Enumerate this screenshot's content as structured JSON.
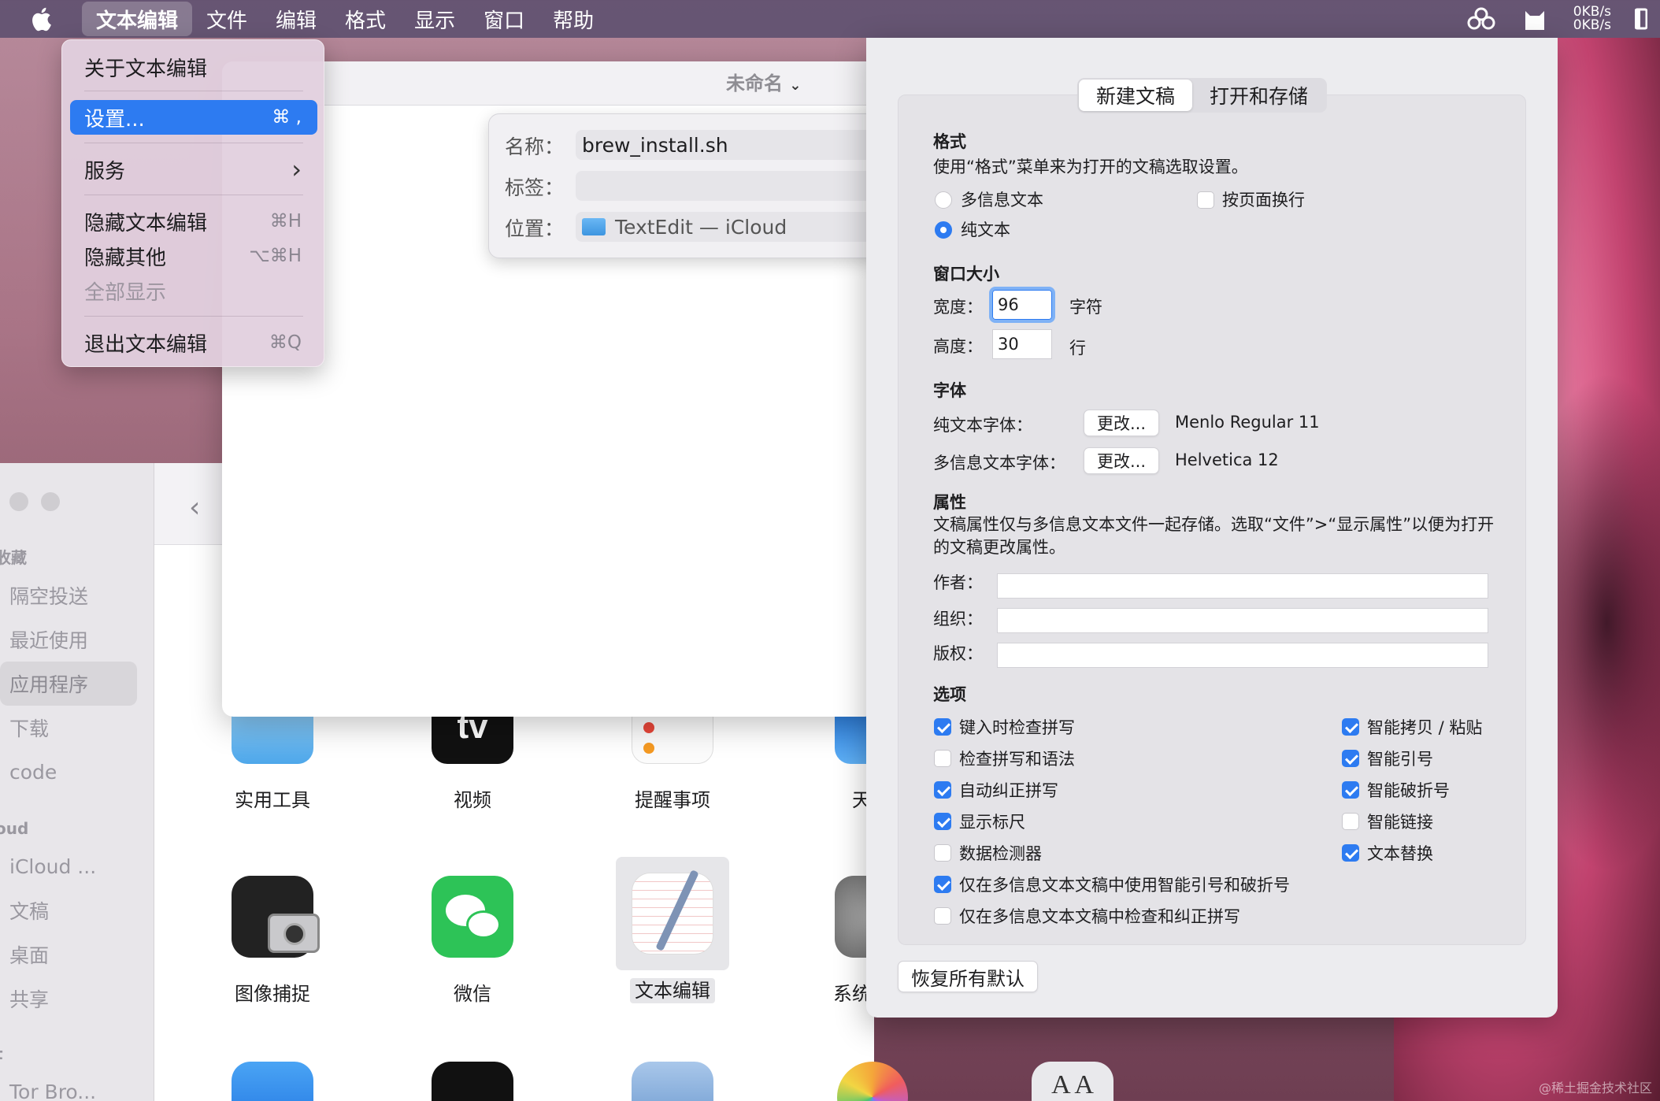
{
  "menubar": {
    "items": [
      "文本编辑",
      "文件",
      "编辑",
      "格式",
      "显示",
      "窗口",
      "帮助"
    ],
    "network_up": "0KB/s",
    "network_down": "0KB/s"
  },
  "app_menu": {
    "about": "关于文本编辑",
    "settings": "设置...",
    "settings_shortcut": "⌘ ,",
    "services": "服务",
    "services_arrow": "›",
    "hide": "隐藏文本编辑",
    "hide_shortcut": "⌘H",
    "hide_others": "隐藏其他",
    "hide_others_shortcut": "⌥⌘H",
    "show_all": "全部显示",
    "quit": "退出文本编辑",
    "quit_shortcut": "⌘Q"
  },
  "document": {
    "title": "未命名",
    "title_chevron": "⌄",
    "save": {
      "name_label": "名称：",
      "name_value": "brew_install.sh",
      "tags_label": "标签：",
      "location_label": "位置：",
      "location_value": "TextEdit — iCloud"
    }
  },
  "finder": {
    "sidebar": {
      "favorites_header": "收藏",
      "icloud_header": "oud",
      "locations_header": "t",
      "items": [
        "隔空投送",
        "最近使用",
        "应用程序",
        "下载",
        "code"
      ],
      "icloud_items": [
        "iCloud ...",
        "文稿",
        "桌面",
        "共享"
      ],
      "other_items": [
        "Tor Bro..."
      ]
    },
    "back": "‹",
    "apps_row1": [
      "实用工具",
      "视频",
      "提醒事项",
      "天"
    ],
    "apps_row2": [
      "图像捕捉",
      "微信",
      "文本编辑",
      "系统"
    ],
    "tv_text": "tv",
    "font_book_text": "A A"
  },
  "settings": {
    "tabs": [
      "新建文稿",
      "打开和存储"
    ],
    "format": {
      "title": "格式",
      "desc": "使用“格式”菜单来为打开的文稿选取设置。",
      "rich": "多信息文本",
      "plain": "纯文本",
      "wrap_to_page": "按页面换行"
    },
    "window_size": {
      "title": "窗口大小",
      "width_label": "宽度：",
      "width_value": "96",
      "width_unit": "字符",
      "height_label": "高度：",
      "height_value": "30",
      "height_unit": "行"
    },
    "fonts": {
      "title": "字体",
      "plain_label": "纯文本字体：",
      "plain_button": "更改...",
      "plain_value": "Menlo Regular 11",
      "rich_label": "多信息文本字体：",
      "rich_button": "更改...",
      "rich_value": "Helvetica 12"
    },
    "properties": {
      "title": "属性",
      "desc": "文稿属性仅与多信息文本文件一起存储。选取“文件”>“显示属性”以便为打开的文稿更改属性。",
      "author": "作者：",
      "organization": "组织：",
      "copyright": "版权："
    },
    "options": {
      "title": "选项",
      "check_spelling": "键入时检查拼写",
      "check_grammar": "检查拼写和语法",
      "autocorrect": "自动纠正拼写",
      "show_ruler": "显示标尺",
      "data_detectors": "数据检测器",
      "smart_rich_only": "仅在多信息文本文稿中使用智能引号和破折号",
      "check_rich_only": "仅在多信息文本文稿中检查和纠正拼写",
      "smart_copy_paste": "智能拷贝 / 粘贴",
      "smart_quotes": "智能引号",
      "smart_dashes": "智能破折号",
      "smart_links": "智能链接",
      "text_replacement": "文本替换"
    },
    "restore_defaults": "恢复所有默认"
  },
  "watermark": "@稀土掘金技术社区",
  "colors": {
    "accent": "#2d7bf1",
    "menubar": "#605070"
  }
}
